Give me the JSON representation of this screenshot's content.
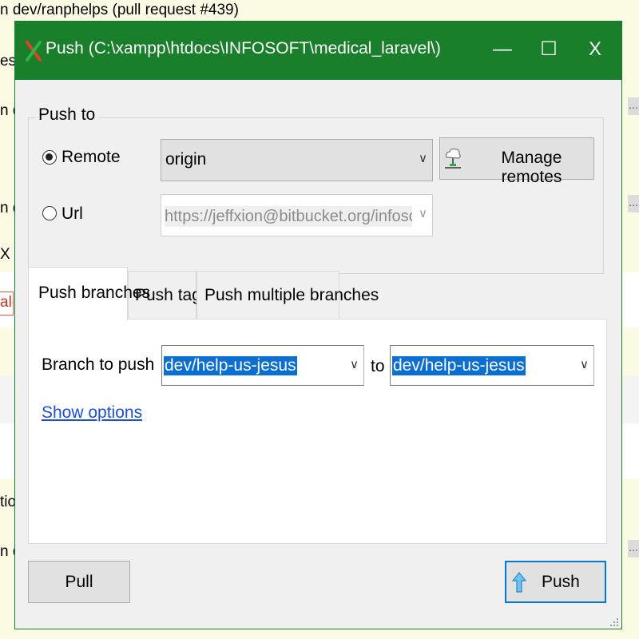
{
  "background": {
    "top_line": "n dev/ranphelps (pull request #439)",
    "fragments": [
      "es",
      "n d",
      "n d",
      "X",
      "al-",
      "tio",
      "n d"
    ],
    "dots": "..."
  },
  "dialog": {
    "title": "Push (C:\\xampp\\htdocs\\INFOSOFT\\medical_laravel\\)",
    "title_buttons": {
      "minimize": "—",
      "maximize": "☐",
      "close": "X"
    },
    "push_to": {
      "legend": "Push to",
      "remote_label": "Remote",
      "remote_selected": true,
      "remote_value": "origin",
      "manage_remotes_label": "Manage remotes",
      "url_label": "Url",
      "url_value": "https://jeffxion@bitbucket.org/infosoftojt/me"
    },
    "tabs": [
      {
        "label": "Push branches",
        "active": true
      },
      {
        "label": "Push tags",
        "active": false
      },
      {
        "label": "Push multiple branches",
        "active": false
      }
    ],
    "branch": {
      "label": "Branch to push",
      "local_value": "dev/help-us-jesus",
      "to_label": "to",
      "remote_value": "dev/help-us-jesus",
      "show_options_label": "Show options"
    },
    "footer": {
      "pull_label": "Pull",
      "push_label": "Push"
    }
  },
  "colors": {
    "titlebar": "#1a7f2a",
    "selection": "#0a6fd1",
    "link": "#1a4fd6",
    "focus_border": "#0078d7"
  }
}
